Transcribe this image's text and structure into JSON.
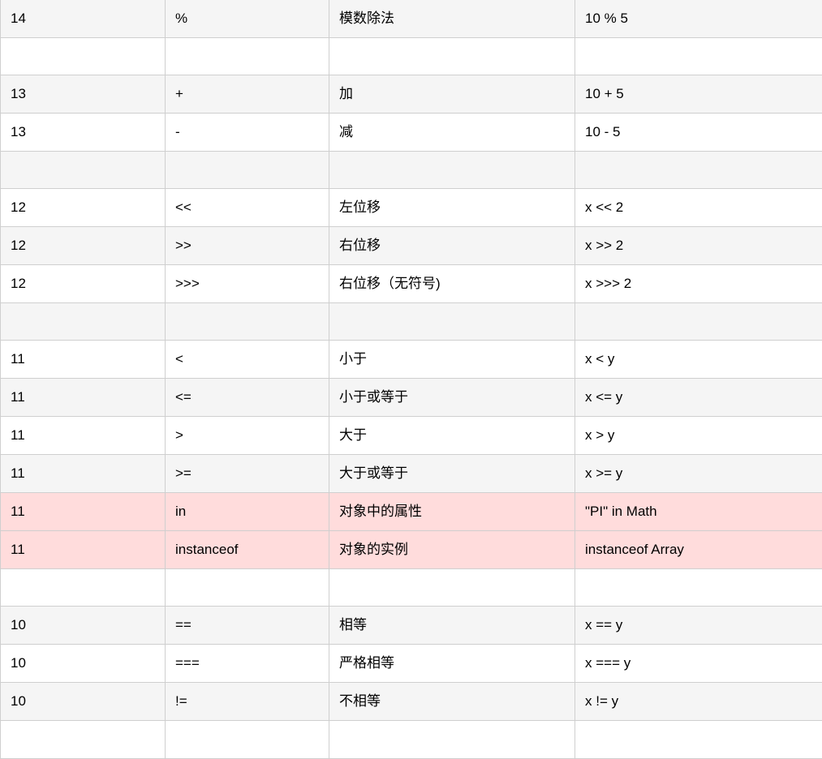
{
  "table": {
    "rows": [
      {
        "kind": "data",
        "bg": "alt",
        "cells": [
          "14",
          "%",
          "模数除法",
          "10 % 5"
        ]
      },
      {
        "kind": "spacer",
        "bg": "plain",
        "cells": [
          "",
          "",
          "",
          ""
        ]
      },
      {
        "kind": "data",
        "bg": "alt",
        "cells": [
          "13",
          "+",
          "加",
          "10 + 5"
        ]
      },
      {
        "kind": "data",
        "bg": "plain",
        "cells": [
          "13",
          "-",
          "减",
          "10 - 5"
        ]
      },
      {
        "kind": "spacer",
        "bg": "alt",
        "cells": [
          "",
          "",
          "",
          ""
        ]
      },
      {
        "kind": "data",
        "bg": "plain",
        "cells": [
          "12",
          "<<",
          "左位移",
          "x << 2"
        ]
      },
      {
        "kind": "data",
        "bg": "alt",
        "cells": [
          "12",
          ">>",
          "右位移",
          "x >> 2"
        ]
      },
      {
        "kind": "data",
        "bg": "plain",
        "cells": [
          "12",
          ">>>",
          "右位移（无符号)",
          "x >>> 2"
        ]
      },
      {
        "kind": "spacer",
        "bg": "alt",
        "cells": [
          "",
          "",
          "",
          ""
        ]
      },
      {
        "kind": "data",
        "bg": "plain",
        "cells": [
          "11",
          "<",
          "小于",
          "x < y"
        ]
      },
      {
        "kind": "data",
        "bg": "alt",
        "cells": [
          "11",
          "<=",
          "小于或等于",
          "x <= y"
        ]
      },
      {
        "kind": "data",
        "bg": "plain",
        "cells": [
          "11",
          ">",
          "大于",
          "x > y"
        ]
      },
      {
        "kind": "data",
        "bg": "alt",
        "cells": [
          "11",
          ">=",
          "大于或等于",
          "x >= y"
        ]
      },
      {
        "kind": "data",
        "bg": "hl",
        "cells": [
          "11",
          "in",
          "对象中的属性",
          "\"PI\" in Math"
        ]
      },
      {
        "kind": "data",
        "bg": "hl",
        "cells": [
          "11",
          "instanceof",
          "对象的实例",
          "instanceof Array"
        ]
      },
      {
        "kind": "spacer",
        "bg": "plain",
        "cells": [
          "",
          "",
          "",
          ""
        ]
      },
      {
        "kind": "data",
        "bg": "alt",
        "cells": [
          "10",
          "==",
          "相等",
          "x == y"
        ]
      },
      {
        "kind": "data",
        "bg": "plain",
        "cells": [
          "10",
          "===",
          "严格相等",
          "x === y"
        ]
      },
      {
        "kind": "data",
        "bg": "alt",
        "cells": [
          "10",
          "!=",
          "不相等",
          "x != y"
        ]
      },
      {
        "kind": "data",
        "bg": "plain",
        "cells": [
          "",
          "",
          "",
          ""
        ]
      }
    ]
  },
  "colors": {
    "alt_row": "#f5f5f5",
    "plain_row": "#ffffff",
    "highlight_row": "#ffdcdc",
    "border": "#cfcfcf"
  }
}
